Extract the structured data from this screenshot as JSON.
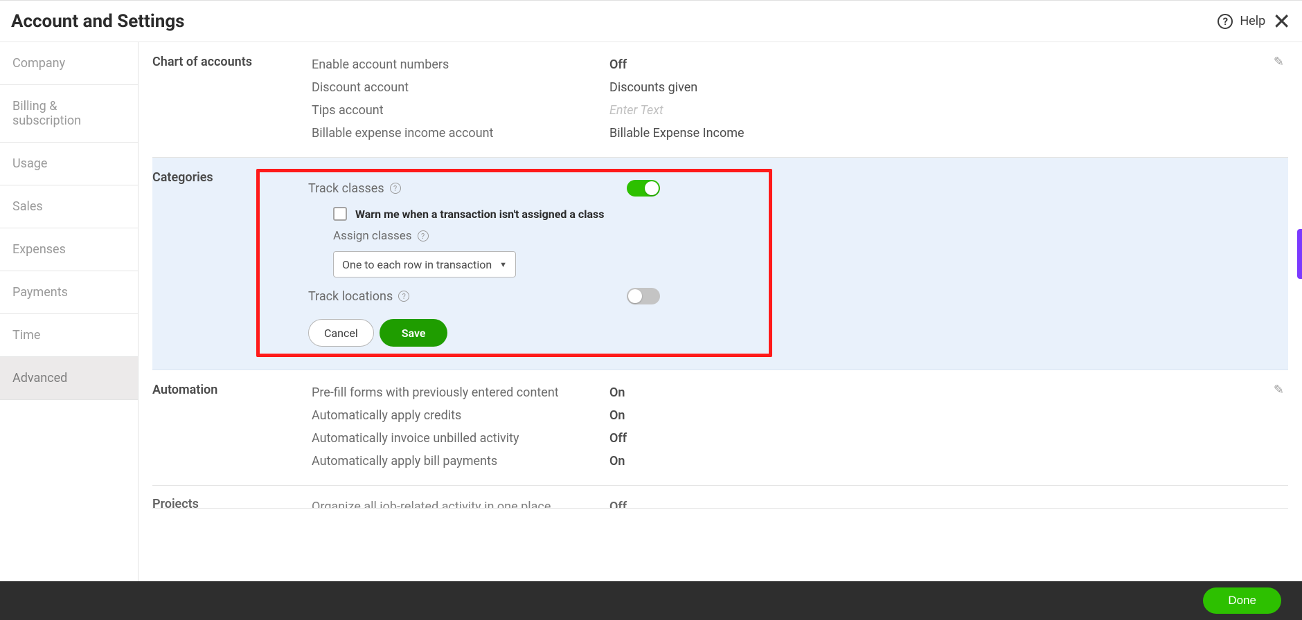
{
  "header": {
    "title": "Account and Settings",
    "help_label": "Help"
  },
  "sidebar": {
    "items": [
      {
        "label": "Company"
      },
      {
        "label": "Billing & subscription"
      },
      {
        "label": "Usage"
      },
      {
        "label": "Sales"
      },
      {
        "label": "Expenses"
      },
      {
        "label": "Payments"
      },
      {
        "label": "Time"
      },
      {
        "label": "Advanced"
      }
    ]
  },
  "sections": {
    "chart": {
      "title": "Chart of accounts",
      "rows": [
        {
          "label": "Enable account numbers",
          "value": "Off"
        },
        {
          "label": "Discount account",
          "value": "Discounts given"
        },
        {
          "label": "Tips account",
          "value": "Enter Text",
          "placeholder": true
        },
        {
          "label": "Billable expense income account",
          "value": "Billable Expense Income"
        }
      ]
    },
    "categories": {
      "title": "Categories",
      "track_classes_label": "Track classes",
      "warn_label": "Warn me when a transaction isn't assigned a class",
      "assign_label": "Assign classes",
      "assign_select": "One to each row in transaction",
      "track_locations_label": "Track locations",
      "cancel": "Cancel",
      "save": "Save"
    },
    "automation": {
      "title": "Automation",
      "rows": [
        {
          "label": "Pre-fill forms with previously entered content",
          "value": "On"
        },
        {
          "label": "Automatically apply credits",
          "value": "On"
        },
        {
          "label": "Automatically invoice unbilled activity",
          "value": "Off"
        },
        {
          "label": "Automatically apply bill payments",
          "value": "On"
        }
      ]
    },
    "projects": {
      "title": "Projects",
      "row_label": "Organize all job-related activity in one place",
      "row_value": "Off"
    }
  },
  "footer": {
    "done": "Done"
  }
}
